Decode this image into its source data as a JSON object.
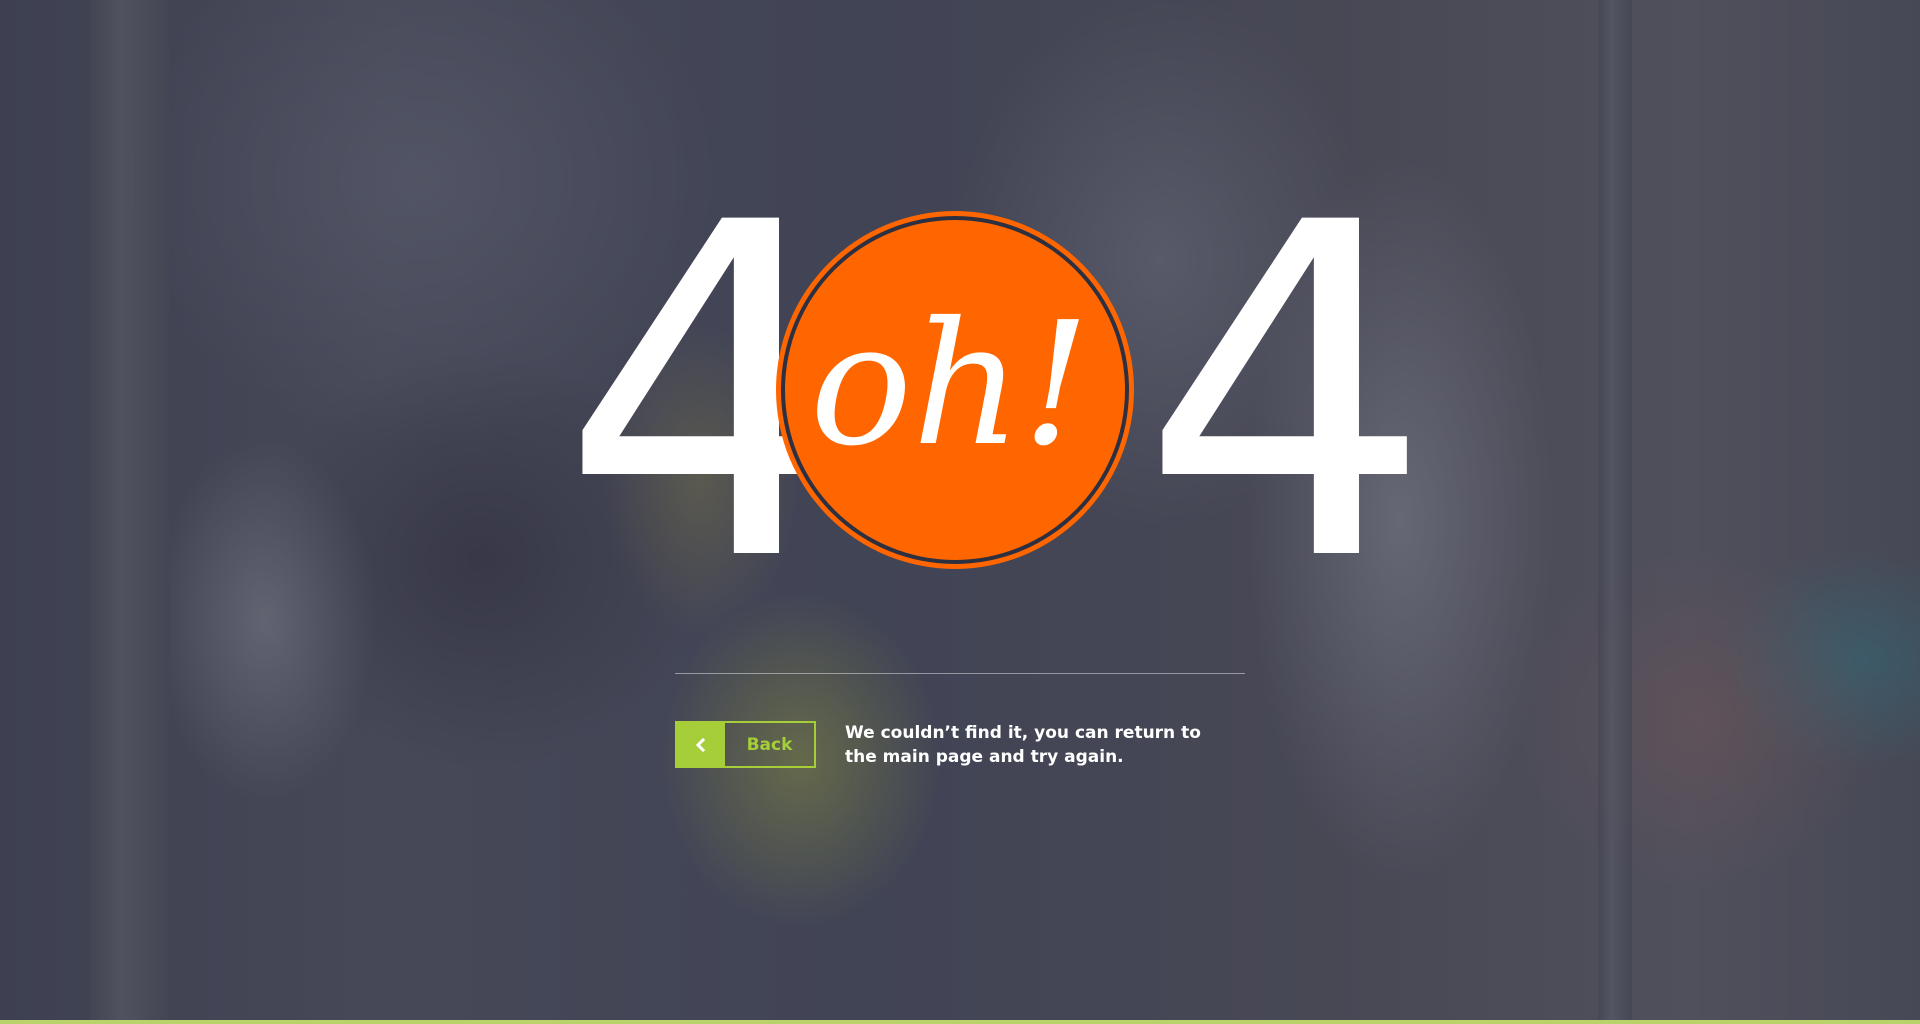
{
  "error": {
    "digit_left": "4",
    "circle_text": "oh!",
    "digit_right": "4"
  },
  "back_button": {
    "label": "Back",
    "icon": "chevron-left-icon"
  },
  "message": "We couldn’t find it, you can return to the main page and try again.",
  "colors": {
    "accent_orange": "#ff6600",
    "accent_green": "#a6ce39",
    "overlay": "#323448",
    "text": "#ffffff"
  }
}
